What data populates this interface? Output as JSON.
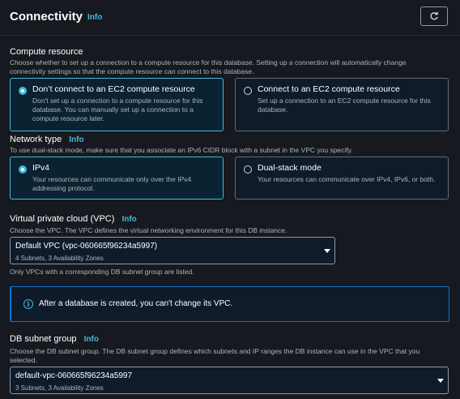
{
  "header": {
    "title": "Connectivity",
    "info": "Info",
    "refresh_icon": "refresh-icon"
  },
  "compute": {
    "label": "Compute resource",
    "desc_line1": "Choose whether to set up a connection to a compute resource for this database. Setting up a connection will automatically change",
    "desc_line2": "connectivity settings so that the compute resource can connect to this database.",
    "options": [
      {
        "title": "Don’t connect to an EC2 compute resource",
        "desc_lines": [
          "Don't set up a connection to a compute resource for this",
          "database. You can manually set up a connection to a",
          "compute resource later."
        ],
        "selected": true
      },
      {
        "title": "Connect to an EC2 compute resource",
        "desc_lines": [
          "Set up a connection to an EC2 compute resource for this",
          "database."
        ],
        "selected": false
      }
    ]
  },
  "network": {
    "label": "Network type",
    "info": "Info",
    "desc": "To use dual-stack mode, make sure that you associate an IPv6 CIDR block with a subnet in the VPC you specify.",
    "options": [
      {
        "title": "IPv4",
        "desc_lines": [
          "Your resources can communicate only over the IPv4",
          "addressing protocol."
        ],
        "selected": true
      },
      {
        "title": "Dual-stack mode",
        "desc_lines": [
          "Your resources can communicate over IPv4, IPv6, or both."
        ],
        "selected": false
      }
    ]
  },
  "vpc": {
    "label": "Virtual private cloud (VPC)",
    "info": "Info",
    "desc": "Choose the VPC. The VPC defines the virtual networking environment for this DB instance.",
    "value": "Default VPC (vpc-060665f96234a5997)",
    "sub": "4 Subnets, 3 Availability Zones",
    "hint": "Only VPCs with a corresponding DB subnet group are listed."
  },
  "alert": {
    "text": "After a database is created, you can't change its VPC.",
    "icon": "info-icon"
  },
  "subnet": {
    "label": "DB subnet group",
    "info": "Info",
    "desc_line1": "Choose the DB subnet group. The DB subnet group defines which subnets and IP ranges the DB instance can use in the VPC that you",
    "desc_line2": "selected.",
    "value": "default-vpc-060665f96234a5997",
    "sub": "3 Subnets, 3 Availability Zones"
  },
  "colors": {
    "accent": "#44b9d6",
    "background": "#16191f",
    "selected_bg": "#0a2231"
  }
}
